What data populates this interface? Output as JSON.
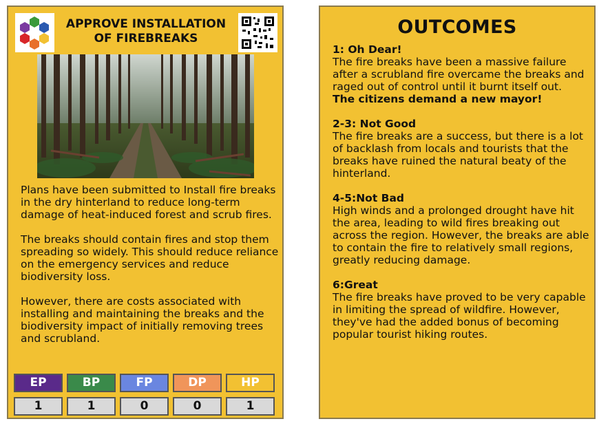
{
  "card": {
    "title_line1": "APPROVE INSTALLATION",
    "title_line2": "OF FIREBREAKS",
    "paragraphs": [
      "Plans have been submitted to Install fire breaks in the dry hinterland to reduce long-term damage of heat-induced forest and scrub fires.",
      "The breaks should contain fires and stop them spreading so widely. This should reduce reliance on the emergency services and reduce biodiversity loss.",
      "However, there are costs associated with installing and maintaining the breaks and the biodiversity impact of initially removing trees and scrubland."
    ],
    "stats": [
      {
        "label": "EP",
        "value": "1",
        "color": "#5a2a8a"
      },
      {
        "label": "BP",
        "value": "1",
        "color": "#3a8a4a"
      },
      {
        "label": "FP",
        "value": "0",
        "color": "#6a86e0"
      },
      {
        "label": "DP",
        "value": "0",
        "color": "#f0955a"
      },
      {
        "label": "HP",
        "value": "1",
        "color": "#f2c132"
      }
    ]
  },
  "outcomes": {
    "title": "OUTCOMES",
    "items": [
      {
        "heading": "1: Oh Dear!",
        "text": "The fire breaks have been a massive failure after a scrubland fire overcame the breaks and raged out of control until it burnt itself out.",
        "extra": "The citizens demand a new mayor!"
      },
      {
        "heading": "2-3: Not Good",
        "text": "The fire breaks are a success, but there is a lot of backlash from locals and tourists that the breaks have ruined the natural beaty of the hinterland."
      },
      {
        "heading": "4-5:Not Bad",
        "text": "High winds and a prolonged drought have hit the area, leading to wild fires breaking out across the region. However, the breaks are able to contain the fire to relatively small regions, greatly reducing damage."
      },
      {
        "heading": "6:Great",
        "text": "The fire breaks have proved to be very capable in limiting the spread of wildfire. However, they've had the added bonus of becoming popular tourist hiking routes."
      }
    ]
  },
  "icons": {
    "logo": "hexagon-sdg-logo-icon",
    "qr": "qr-code-icon"
  }
}
